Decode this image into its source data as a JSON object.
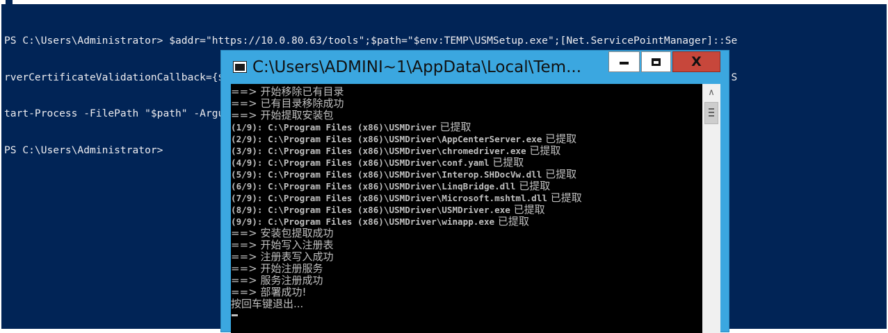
{
  "powershell": {
    "lines": [
      "PS C:\\Users\\Administrator> $addr=\"https://10.0.80.63/tools\";$path=\"$env:TEMP\\USMSetup.exe\";[Net.ServicePointManager]::Se",
      "rverCertificateValidationCallback={$true};(new-object System.Net.WebClient).DownloadFile(\"$addr/USMSetup.exe\",\"$path\");S",
      "tart-Process -FilePath \"$path\" -ArgumentList \"-ak=ef7d9ef0ed7fa1a4 -sk=3509b93878915b50 -zip_url=$addr/USMDriver.zip\";",
      "PS C:\\Users\\Administrator>"
    ],
    "background_color": "#012456"
  },
  "cmd_window": {
    "title": "C:\\Users\\ADMINI~1\\AppData\\Local\\Tem...",
    "buttons": {
      "minimize_icon": "minimize-icon",
      "maximize_icon": "maximize-icon",
      "close_label": "X"
    },
    "frame_color": "#3ba7e0",
    "close_color": "#c7473b",
    "console": {
      "lines": [
        {
          "kind": "zh",
          "text": "==> 开始移除已有目录"
        },
        {
          "kind": "zh",
          "text": "==> 已有目录移除成功"
        },
        {
          "kind": "zh",
          "text": "==> 开始提取安装包"
        },
        {
          "kind": "path",
          "text": "(1/9): C:\\Program Files (x86)\\USMDriver",
          "suffix": " 已提取"
        },
        {
          "kind": "path",
          "text": "(2/9): C:\\Program Files (x86)\\USMDriver\\AppCenterServer.exe",
          "suffix": " 已提取"
        },
        {
          "kind": "path",
          "text": "(3/9): C:\\Program Files (x86)\\USMDriver\\chromedriver.exe",
          "suffix": " 已提取"
        },
        {
          "kind": "path",
          "text": "(4/9): C:\\Program Files (x86)\\USMDriver\\conf.yaml",
          "suffix": " 已提取"
        },
        {
          "kind": "path",
          "text": "(5/9): C:\\Program Files (x86)\\USMDriver\\Interop.SHDocVw.dll",
          "suffix": " 已提取"
        },
        {
          "kind": "path",
          "text": "(6/9): C:\\Program Files (x86)\\USMDriver\\LinqBridge.dll",
          "suffix": " 已提取"
        },
        {
          "kind": "path",
          "text": "(7/9): C:\\Program Files (x86)\\USMDriver\\Microsoft.mshtml.dll",
          "suffix": " 已提取"
        },
        {
          "kind": "path",
          "text": "(8/9): C:\\Program Files (x86)\\USMDriver\\USMDriver.exe",
          "suffix": " 已提取"
        },
        {
          "kind": "path",
          "text": "(9/9): C:\\Program Files (x86)\\USMDriver\\winapp.exe",
          "suffix": " 已提取"
        },
        {
          "kind": "zh",
          "text": "==> 安装包提取成功"
        },
        {
          "kind": "zh",
          "text": "==> 开始写入注册表"
        },
        {
          "kind": "zh",
          "text": "==> 注册表写入成功"
        },
        {
          "kind": "zh",
          "text": "==> 开始注册服务"
        },
        {
          "kind": "zh",
          "text": "==> 服务注册成功"
        },
        {
          "kind": "zh",
          "text": "==> 部署成功!"
        },
        {
          "kind": "zh",
          "text": "按回车键退出..."
        }
      ]
    },
    "scrollbar": {
      "up_icon": "chevron-up-icon",
      "thumb_icon": "grip-icon"
    }
  }
}
